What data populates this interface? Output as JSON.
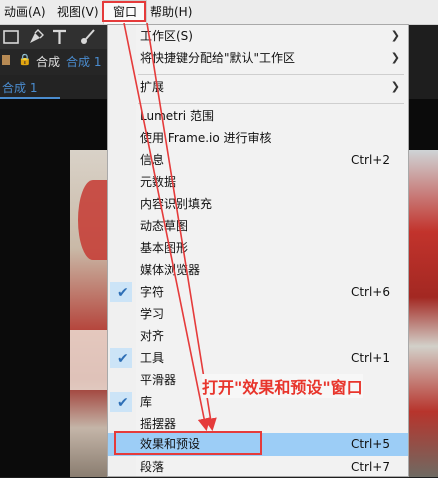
{
  "menubar": {
    "items": [
      "动画(A)",
      "视图(V)",
      "窗口",
      "帮助(H)"
    ]
  },
  "panel": {
    "comp_label": "合成",
    "comp_tab_suffix": "合成 1",
    "comp_tab": "合成 1"
  },
  "menu": {
    "items": [
      {
        "label": "工作区(S)",
        "shortcut": "",
        "submenu": true,
        "checked": false
      },
      {
        "label": "将快捷键分配给\"默认\"工作区",
        "shortcut": "",
        "submenu": true,
        "checked": false
      },
      {
        "label": "扩展",
        "shortcut": "",
        "submenu": true,
        "checked": false
      },
      {
        "label": "Lumetri 范围",
        "shortcut": "",
        "submenu": false,
        "checked": false
      },
      {
        "label": "使用 Frame.io 进行审核",
        "shortcut": "",
        "submenu": false,
        "checked": false
      },
      {
        "label": "信息",
        "shortcut": "Ctrl+2",
        "submenu": false,
        "checked": false
      },
      {
        "label": "元数据",
        "shortcut": "",
        "submenu": false,
        "checked": false
      },
      {
        "label": "内容识别填充",
        "shortcut": "",
        "submenu": false,
        "checked": false
      },
      {
        "label": "动态草图",
        "shortcut": "",
        "submenu": false,
        "checked": false
      },
      {
        "label": "基本图形",
        "shortcut": "",
        "submenu": false,
        "checked": false
      },
      {
        "label": "媒体浏览器",
        "shortcut": "",
        "submenu": false,
        "checked": false
      },
      {
        "label": "字符",
        "shortcut": "Ctrl+6",
        "submenu": false,
        "checked": true
      },
      {
        "label": "学习",
        "shortcut": "",
        "submenu": false,
        "checked": false
      },
      {
        "label": "对齐",
        "shortcut": "",
        "submenu": false,
        "checked": false
      },
      {
        "label": "工具",
        "shortcut": "Ctrl+1",
        "submenu": false,
        "checked": true
      },
      {
        "label": "平滑器",
        "shortcut": "",
        "submenu": false,
        "checked": false
      },
      {
        "label": "库",
        "shortcut": "",
        "submenu": false,
        "checked": true
      },
      {
        "label": "摇摆器",
        "shortcut": "",
        "submenu": false,
        "checked": false
      },
      {
        "label": "效果和预设",
        "shortcut": "Ctrl+5",
        "submenu": false,
        "checked": false,
        "selected": true
      },
      {
        "label": "段落",
        "shortcut": "Ctrl+7",
        "submenu": false,
        "checked": false
      }
    ]
  },
  "annotation": {
    "text": "打开\"效果和预设\"窗口",
    "color": "#e8352c"
  },
  "colors": {
    "highlight": "#e53b3b",
    "selected_bg": "#9ccdf6",
    "check": "#2e6fb6"
  }
}
